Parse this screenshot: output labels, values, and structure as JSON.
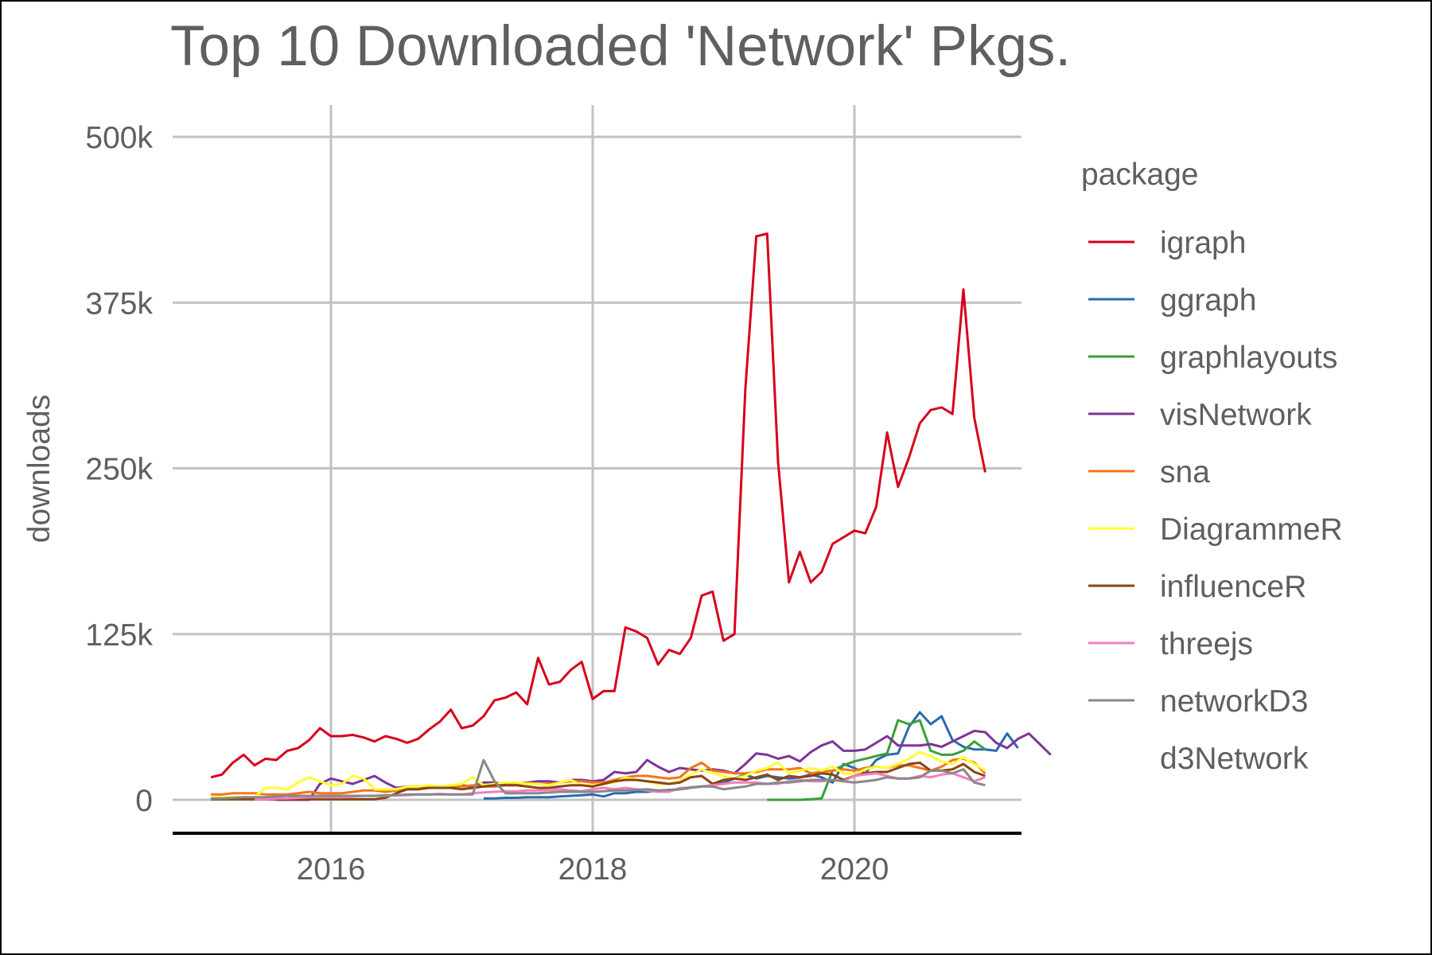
{
  "chart_data": {
    "type": "line",
    "title": "Top 10 Downloaded 'Network' Pkgs.",
    "xlabel": "",
    "ylabel": "downloads",
    "xlim": [
      2015.0,
      2021.25
    ],
    "ylim": [
      0,
      500000
    ],
    "x_ticks": [
      {
        "value": 2016,
        "label": "2016"
      },
      {
        "value": 2018,
        "label": "2018"
      },
      {
        "value": 2020,
        "label": "2020"
      }
    ],
    "y_ticks": [
      {
        "value": 0,
        "label": "0"
      },
      {
        "value": 125000,
        "label": "125k"
      },
      {
        "value": 250000,
        "label": "250k"
      },
      {
        "value": 375000,
        "label": "375k"
      },
      {
        "value": 500000,
        "label": "500k"
      }
    ],
    "grid": true,
    "legend": {
      "title": "package",
      "position": "right"
    },
    "x_start": 2015.083,
    "x_step_months": 1,
    "series": [
      {
        "name": "igraph",
        "color": "#d7001c",
        "start_index": 0,
        "values": [
          17000,
          19000,
          28000,
          34000,
          26000,
          31000,
          30000,
          37000,
          39000,
          45000,
          54000,
          48000,
          48000,
          49000,
          47000,
          44000,
          48000,
          46000,
          43000,
          46000,
          53000,
          59000,
          68000,
          54000,
          56000,
          63000,
          75000,
          77000,
          81000,
          72000,
          107000,
          87000,
          89000,
          98000,
          104000,
          76000,
          82000,
          82000,
          130000,
          127000,
          122000,
          102000,
          113000,
          110000,
          122000,
          154000,
          157000,
          120000,
          125000,
          310000,
          425000,
          427000,
          255000,
          164000,
          187000,
          164000,
          172000,
          193000,
          198000,
          203000,
          201000,
          221000,
          277000,
          236000,
          258000,
          284000,
          294000,
          296000,
          291000,
          385000,
          288000,
          247000
        ]
      },
      {
        "name": "ggraph",
        "color": "#2a6bb0",
        "start_index": 25,
        "values": [
          1000,
          1000,
          1500,
          1500,
          2000,
          2000,
          2000,
          2500,
          3000,
          3500,
          4000,
          2500,
          5000,
          5000,
          6000,
          6000,
          7000,
          7000,
          8000,
          9000,
          10000,
          11000,
          13000,
          16000,
          19000,
          16000,
          18000,
          17000,
          16000,
          17000,
          19000,
          17000,
          13000,
          27000,
          24000,
          20000,
          30000,
          34000,
          35000,
          55000,
          66000,
          57000,
          63000,
          45000,
          40000,
          38000,
          38000,
          37000,
          50000,
          39000
        ]
      },
      {
        "name": "graphlayouts",
        "color": "#3a9e3a",
        "start_index": 51,
        "values": [
          0,
          0,
          0,
          0,
          500,
          1000,
          22000,
          26000,
          29000,
          31000,
          33000,
          35000,
          60000,
          57000,
          60000,
          37000,
          34000,
          34000,
          37000,
          44000,
          38000
        ]
      },
      {
        "name": "visNetwork",
        "color": "#7e3596",
        "start_index": 6,
        "values": [
          0,
          0,
          0,
          0,
          12000,
          16000,
          14000,
          12000,
          15000,
          18000,
          13000,
          9000,
          10000,
          10000,
          9000,
          9000,
          9000,
          11000,
          10000,
          13000,
          13000,
          12000,
          12000,
          13000,
          14000,
          14000,
          13000,
          15000,
          15000,
          14000,
          15000,
          21000,
          20000,
          21000,
          30000,
          25000,
          21000,
          24000,
          23000,
          22000,
          23000,
          22000,
          20000,
          27000,
          35000,
          34000,
          31000,
          33000,
          29000,
          36000,
          41000,
          44000,
          37000,
          37000,
          38000,
          43000,
          48000,
          41000,
          41000,
          41000,
          42000,
          40000,
          44000,
          48000,
          52000,
          51000,
          43000,
          39000,
          46000,
          50000,
          42000,
          34000
        ]
      },
      {
        "name": "sna",
        "color": "#f4741c",
        "start_index": 0,
        "values": [
          4000,
          4000,
          5000,
          5000,
          5000,
          4000,
          4000,
          4000,
          5000,
          6000,
          5000,
          5000,
          5000,
          6000,
          7000,
          7000,
          6000,
          7000,
          8000,
          8000,
          9000,
          10000,
          10000,
          10000,
          11000,
          10000,
          10000,
          11000,
          12000,
          13000,
          12000,
          12000,
          13000,
          14000,
          14000,
          13000,
          13000,
          15000,
          17000,
          18000,
          18000,
          17000,
          16000,
          17000,
          24000,
          28000,
          22000,
          21000,
          20000,
          20000,
          21000,
          23000,
          23000,
          23000,
          24000,
          20000,
          21000,
          22000,
          23000,
          22000,
          24000,
          25000,
          24000,
          26000,
          26000,
          24000,
          22000,
          25000,
          30000,
          31000,
          28000,
          20000
        ]
      },
      {
        "name": "DiagrammeR",
        "color": "#ffff33",
        "start_index": 0,
        "values": [
          2000,
          2000,
          2000,
          2000,
          2000,
          9000,
          9000,
          8000,
          13000,
          17000,
          14000,
          11000,
          12000,
          18000,
          16000,
          8000,
          8000,
          8000,
          10000,
          10000,
          11000,
          10000,
          11000,
          12000,
          17000,
          11000,
          12000,
          13000,
          13000,
          12000,
          12000,
          11000,
          13000,
          15000,
          11000,
          11000,
          12000,
          13000,
          17000,
          15000,
          14000,
          12000,
          12000,
          14000,
          19000,
          23000,
          20000,
          18000,
          16000,
          18000,
          22000,
          24000,
          28000,
          20000,
          22000,
          24000,
          22000,
          25000,
          20000,
          19000,
          23000,
          25000,
          24000,
          27000,
          31000,
          36000,
          33000,
          29000,
          27000,
          32000,
          27000,
          22000
        ]
      },
      {
        "name": "influenceR",
        "color": "#8b4513",
        "start_index": 0,
        "values": [
          500,
          500,
          500,
          500,
          500,
          500,
          500,
          500,
          500,
          500,
          500,
          500,
          500,
          500,
          500,
          500,
          1500,
          5000,
          8000,
          8000,
          9000,
          9000,
          9000,
          8000,
          9000,
          10000,
          11000,
          11000,
          11000,
          10000,
          9000,
          9000,
          10000,
          11000,
          11000,
          10000,
          12000,
          14000,
          15000,
          15000,
          14000,
          13000,
          12000,
          13000,
          17000,
          18000,
          12000,
          15000,
          16000,
          15000,
          17000,
          19000,
          15000,
          18000,
          17000,
          18000,
          20000,
          19000,
          15000,
          18000,
          20000,
          21000,
          21000,
          24000,
          27000,
          28000,
          22000,
          22000,
          23000,
          27000,
          21000,
          18000
        ]
      },
      {
        "name": "threejs",
        "color": "#f27fbf",
        "start_index": 4,
        "values": [
          500,
          500,
          1000,
          1000,
          1500,
          2000,
          2000,
          2000,
          2000,
          2500,
          3000,
          3000,
          3000,
          3500,
          3500,
          4000,
          4000,
          4500,
          4000,
          4000,
          5000,
          5500,
          6000,
          6500,
          6500,
          7000,
          7000,
          7500,
          8000,
          7000,
          6500,
          8000,
          9000,
          8000,
          9000,
          8000,
          7000,
          6000,
          6000,
          9000,
          9000,
          10000,
          11000,
          12000,
          13000,
          13000,
          13000,
          12000,
          12000,
          14000,
          15000,
          14000,
          14000,
          15000,
          14000,
          18000,
          19000,
          20000,
          18000,
          16000,
          16000,
          18000,
          17000,
          19000,
          20000,
          17000,
          14000,
          17000
        ]
      },
      {
        "name": "networkD3",
        "color": "#888888",
        "start_index": 0,
        "values": [
          1000,
          1000,
          1500,
          2000,
          2000,
          2000,
          2500,
          3000,
          3000,
          3000,
          3000,
          3000,
          3000,
          3000,
          3000,
          3000,
          3500,
          3500,
          4000,
          4000,
          4000,
          4000,
          4000,
          4000,
          4000,
          30000,
          14000,
          5000,
          5000,
          5000,
          5000,
          5500,
          6000,
          6000,
          6000,
          6000,
          6500,
          7000,
          7000,
          7500,
          8000,
          7000,
          7500,
          8000,
          9500,
          10000,
          10000,
          8000,
          9000,
          10000,
          12000,
          12000,
          13000,
          13000,
          14000,
          15000,
          15000,
          15000,
          14000,
          13000,
          14000,
          15000,
          17000,
          16000,
          16000,
          17000,
          22000,
          22000,
          20000,
          23000,
          13000,
          11000
        ]
      },
      {
        "name": "d3Network",
        "color": "#ffffff",
        "start_index": 0,
        "values": []
      }
    ]
  }
}
